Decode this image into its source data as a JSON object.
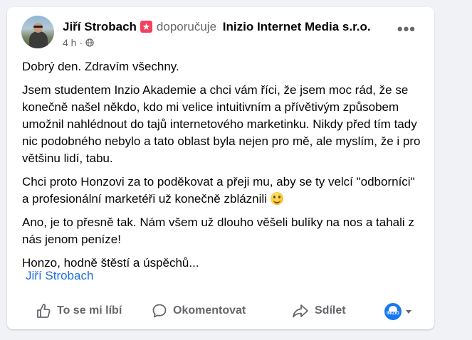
{
  "post": {
    "author": "Jiří Strobach",
    "recommends_text": "doporučuje",
    "page_name": "Inizio Internet Media s.r.o.",
    "time": "4 h",
    "dot": "·",
    "more_label": "•••",
    "paragraphs": [
      "Dobrý den. Zdravím všechny.",
      "Jsem studentem Inzio Akademie a chci vám říci, že jsem moc rád, že se konečně našel někdo, kdo mi velice intuitivním a přívětivým způsobem umožnil nahlédnout do tajů internetového marketinku. Nikdy před tím tady nic podobného nebylo a tato oblast byla nejen pro mě, ale myslím, že i pro většinu lidí, tabu.",
      "Chci proto Honzovi za to poděkovat a přeji mu, aby se ty velcí \"odborníci\" a profesionální marketéři už konečně zbláznili",
      "Ano, je to přesně tak. Nám všem už dlouho věšeli bulíky na nos a tahali z nás jenom peníze!",
      "Honzo, hodně štěstí a úspěchů..."
    ],
    "signature": "Jiří Strobach"
  },
  "actions": {
    "like": "To se mi líbí",
    "comment": "Okomentovat",
    "share": "Sdílet",
    "reaction_avatar_text": "INIZIO"
  },
  "colors": {
    "accent": "#216fdb",
    "recommend_badge": "#f3425f",
    "secondary_text": "#65676b"
  }
}
